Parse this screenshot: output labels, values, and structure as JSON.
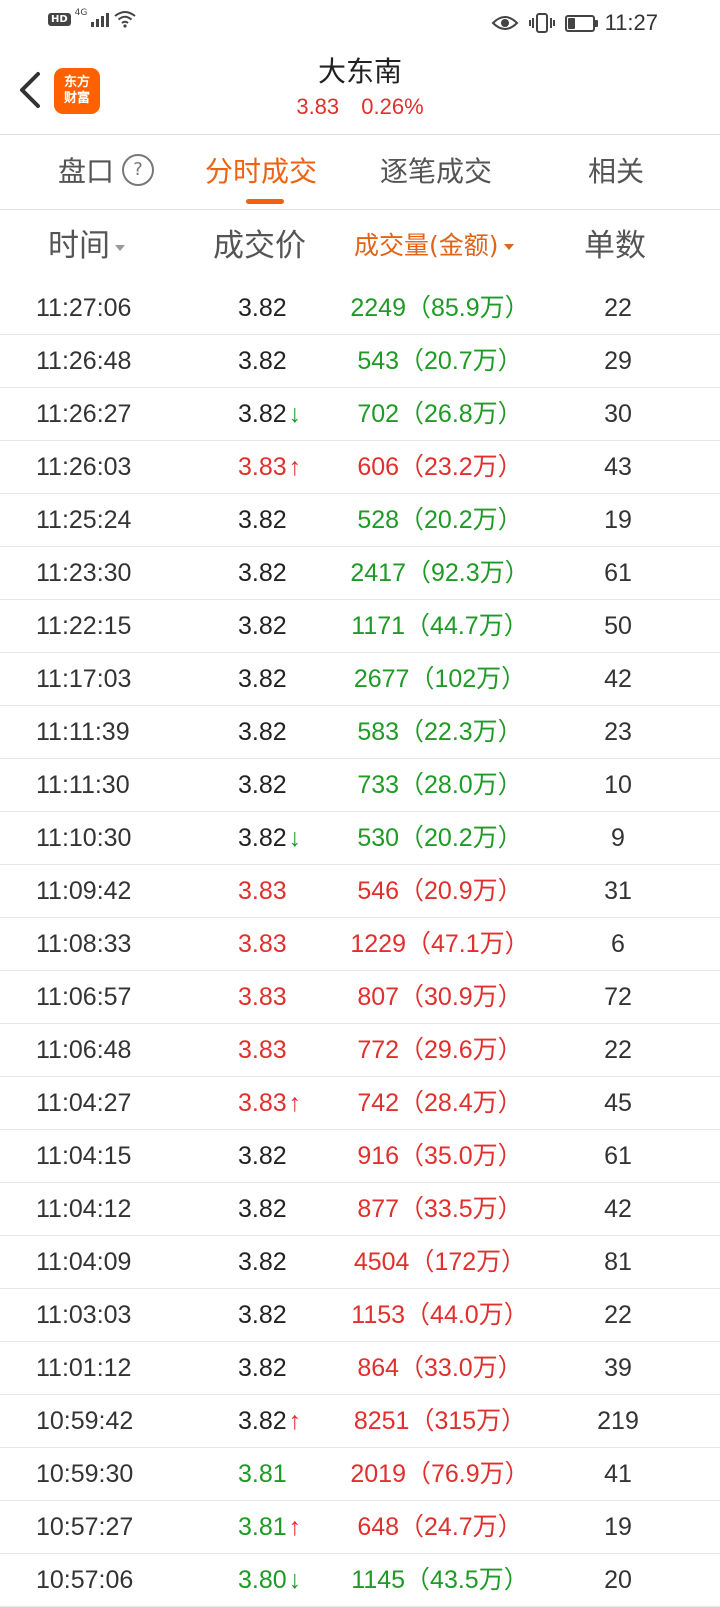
{
  "status_bar": {
    "hd": "HD",
    "network": "4G",
    "time": "11:27",
    "battery_level": 0.3
  },
  "header": {
    "logo_text": [
      "东方",
      "财富"
    ],
    "title": "大东南",
    "price": "3.83",
    "change": "0.26%"
  },
  "tabs": [
    {
      "label": "盘口"
    },
    {
      "label": "分时成交"
    },
    {
      "label": "逐笔成交"
    },
    {
      "label": "相关"
    }
  ],
  "columns": {
    "time": "时间",
    "price": "成交价",
    "volume": "成交量(金额)",
    "count": "单数"
  },
  "colors": {
    "red": "#e0302d",
    "green": "#1f9a26",
    "accent": "#ee6212"
  },
  "rows": [
    {
      "time": "11:27:06",
      "price": "3.82",
      "price_color": "black",
      "arrow": "",
      "volume": "2249（85.9万）",
      "vol_color": "green",
      "count": "22"
    },
    {
      "time": "11:26:48",
      "price": "3.82",
      "price_color": "black",
      "arrow": "",
      "volume": "543（20.7万）",
      "vol_color": "green",
      "count": "29"
    },
    {
      "time": "11:26:27",
      "price": "3.82",
      "price_color": "black",
      "arrow": "down",
      "volume": "702（26.8万）",
      "vol_color": "green",
      "count": "30"
    },
    {
      "time": "11:26:03",
      "price": "3.83",
      "price_color": "red",
      "arrow": "up",
      "volume": "606（23.2万）",
      "vol_color": "red",
      "count": "43"
    },
    {
      "time": "11:25:24",
      "price": "3.82",
      "price_color": "black",
      "arrow": "",
      "volume": "528（20.2万）",
      "vol_color": "green",
      "count": "19"
    },
    {
      "time": "11:23:30",
      "price": "3.82",
      "price_color": "black",
      "arrow": "",
      "volume": "2417（92.3万）",
      "vol_color": "green",
      "count": "61"
    },
    {
      "time": "11:22:15",
      "price": "3.82",
      "price_color": "black",
      "arrow": "",
      "volume": "1171（44.7万）",
      "vol_color": "green",
      "count": "50"
    },
    {
      "time": "11:17:03",
      "price": "3.82",
      "price_color": "black",
      "arrow": "",
      "volume": "2677（102万）",
      "vol_color": "green",
      "count": "42"
    },
    {
      "time": "11:11:39",
      "price": "3.82",
      "price_color": "black",
      "arrow": "",
      "volume": "583（22.3万）",
      "vol_color": "green",
      "count": "23"
    },
    {
      "time": "11:11:30",
      "price": "3.82",
      "price_color": "black",
      "arrow": "",
      "volume": "733（28.0万）",
      "vol_color": "green",
      "count": "10"
    },
    {
      "time": "11:10:30",
      "price": "3.82",
      "price_color": "black",
      "arrow": "down",
      "volume": "530（20.2万）",
      "vol_color": "green",
      "count": "9"
    },
    {
      "time": "11:09:42",
      "price": "3.83",
      "price_color": "red",
      "arrow": "",
      "volume": "546（20.9万）",
      "vol_color": "red",
      "count": "31"
    },
    {
      "time": "11:08:33",
      "price": "3.83",
      "price_color": "red",
      "arrow": "",
      "volume": "1229（47.1万）",
      "vol_color": "red",
      "count": "6"
    },
    {
      "time": "11:06:57",
      "price": "3.83",
      "price_color": "red",
      "arrow": "",
      "volume": "807（30.9万）",
      "vol_color": "red",
      "count": "72"
    },
    {
      "time": "11:06:48",
      "price": "3.83",
      "price_color": "red",
      "arrow": "",
      "volume": "772（29.6万）",
      "vol_color": "red",
      "count": "22"
    },
    {
      "time": "11:04:27",
      "price": "3.83",
      "price_color": "red",
      "arrow": "up",
      "volume": "742（28.4万）",
      "vol_color": "red",
      "count": "45"
    },
    {
      "time": "11:04:15",
      "price": "3.82",
      "price_color": "black",
      "arrow": "",
      "volume": "916（35.0万）",
      "vol_color": "red",
      "count": "61"
    },
    {
      "time": "11:04:12",
      "price": "3.82",
      "price_color": "black",
      "arrow": "",
      "volume": "877（33.5万）",
      "vol_color": "red",
      "count": "42"
    },
    {
      "time": "11:04:09",
      "price": "3.82",
      "price_color": "black",
      "arrow": "",
      "volume": "4504（172万）",
      "vol_color": "red",
      "count": "81"
    },
    {
      "time": "11:03:03",
      "price": "3.82",
      "price_color": "black",
      "arrow": "",
      "volume": "1153（44.0万）",
      "vol_color": "red",
      "count": "22"
    },
    {
      "time": "11:01:12",
      "price": "3.82",
      "price_color": "black",
      "arrow": "",
      "volume": "864（33.0万）",
      "vol_color": "red",
      "count": "39"
    },
    {
      "time": "10:59:42",
      "price": "3.82",
      "price_color": "black",
      "arrow": "up",
      "volume": "8251（315万）",
      "vol_color": "red",
      "count": "219"
    },
    {
      "time": "10:59:30",
      "price": "3.81",
      "price_color": "green",
      "arrow": "",
      "volume": "2019（76.9万）",
      "vol_color": "red",
      "count": "41"
    },
    {
      "time": "10:57:27",
      "price": "3.81",
      "price_color": "green",
      "arrow": "up",
      "volume": "648（24.7万）",
      "vol_color": "red",
      "count": "19"
    },
    {
      "time": "10:57:06",
      "price": "3.80",
      "price_color": "green",
      "arrow": "down",
      "volume": "1145（43.5万）",
      "vol_color": "green",
      "count": "20"
    }
  ]
}
